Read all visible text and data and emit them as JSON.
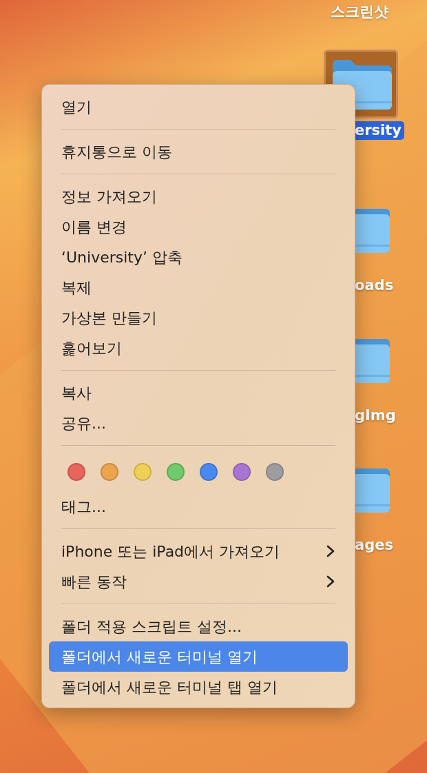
{
  "desktop_icons": [
    {
      "label": "스크린샷",
      "has_folder": false,
      "selected": false
    },
    {
      "label": "ersity",
      "has_folder": true,
      "selected": true
    },
    {
      "label": "oads",
      "has_folder": true,
      "selected": false
    },
    {
      "label": "gImg",
      "has_folder": true,
      "selected": false
    },
    {
      "label": "ages",
      "has_folder": true,
      "selected": false
    }
  ],
  "context_menu": {
    "groups": [
      [
        {
          "kind": "item",
          "label": "열기",
          "selected": false
        }
      ],
      [
        {
          "kind": "item",
          "label": "휴지통으로 이동",
          "selected": false
        }
      ],
      [
        {
          "kind": "item",
          "label": "정보 가져오기",
          "selected": false
        },
        {
          "kind": "item",
          "label": "이름 변경",
          "selected": false
        },
        {
          "kind": "item",
          "label": "‘University’ 압축",
          "selected": false
        },
        {
          "kind": "item",
          "label": "복제",
          "selected": false
        },
        {
          "kind": "item",
          "label": "가상본 만들기",
          "selected": false
        },
        {
          "kind": "item",
          "label": "훑어보기",
          "selected": false
        }
      ],
      [
        {
          "kind": "item",
          "label": "복사",
          "selected": false
        },
        {
          "kind": "item",
          "label": "공유...",
          "selected": false
        }
      ],
      [
        {
          "kind": "tags",
          "tags": [
            {
              "color": "#e8655c"
            },
            {
              "color": "#eca54d"
            },
            {
              "color": "#f0cf55"
            },
            {
              "color": "#6fcb6c"
            },
            {
              "color": "#4a8af0"
            },
            {
              "color": "#a975d2"
            },
            {
              "color": "#9d9ca0"
            }
          ]
        },
        {
          "kind": "item",
          "label": "태그...",
          "selected": false
        }
      ],
      [
        {
          "kind": "item",
          "label": "iPhone 또는 iPad에서 가져오기",
          "submenu": true,
          "selected": false
        },
        {
          "kind": "item",
          "label": "빠른 동작",
          "submenu": true,
          "selected": false
        }
      ],
      [
        {
          "kind": "item",
          "label": "폴더 적용 스크립트 설정...",
          "selected": false
        },
        {
          "kind": "item",
          "label": "폴더에서 새로운 터미널 열기",
          "selected": true
        },
        {
          "kind": "item",
          "label": "폴더에서 새로운 터미널 탭 열기",
          "selected": false
        }
      ]
    ]
  }
}
